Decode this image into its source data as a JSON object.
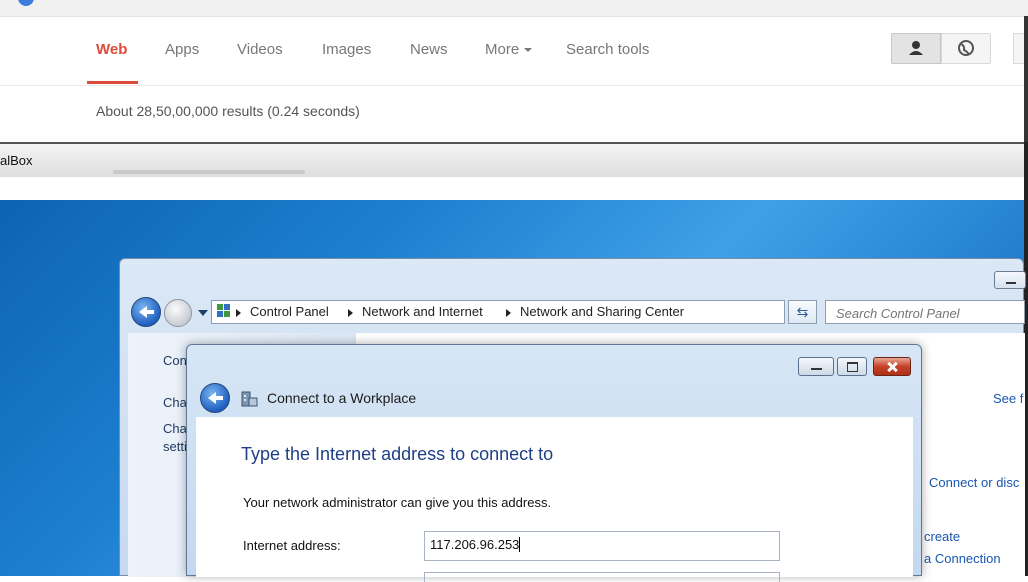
{
  "google": {
    "tabs": [
      {
        "label": "Web",
        "active": true
      },
      {
        "label": "Apps"
      },
      {
        "label": "Videos"
      },
      {
        "label": "Images"
      },
      {
        "label": "News"
      },
      {
        "label": "More"
      },
      {
        "label": "Search tools"
      }
    ],
    "results_summary": "About 28,50,00,000 results (0.24 seconds)",
    "accent_color": "#dd4b39",
    "icons": [
      "person-icon",
      "globe-icon"
    ]
  },
  "virtualbox": {
    "title_fragment": "alBox"
  },
  "control_panel": {
    "breadcrumbs": [
      "Control Panel",
      "Network and Internet",
      "Network and Sharing Center"
    ],
    "search_placeholder": "Search Control Panel",
    "left_fragments": [
      "Con",
      "Cha",
      "Cha",
      "setti"
    ],
    "right_fragments": [
      "See f",
      "Connect or disc",
      "create",
      "a Connection"
    ]
  },
  "dialog": {
    "title": "Connect to a Workplace",
    "heading": "Type the Internet address to connect to",
    "hint": "Your network administrator can give you this address.",
    "address_label": "Internet address:",
    "address_value": "117.206.96.253"
  }
}
